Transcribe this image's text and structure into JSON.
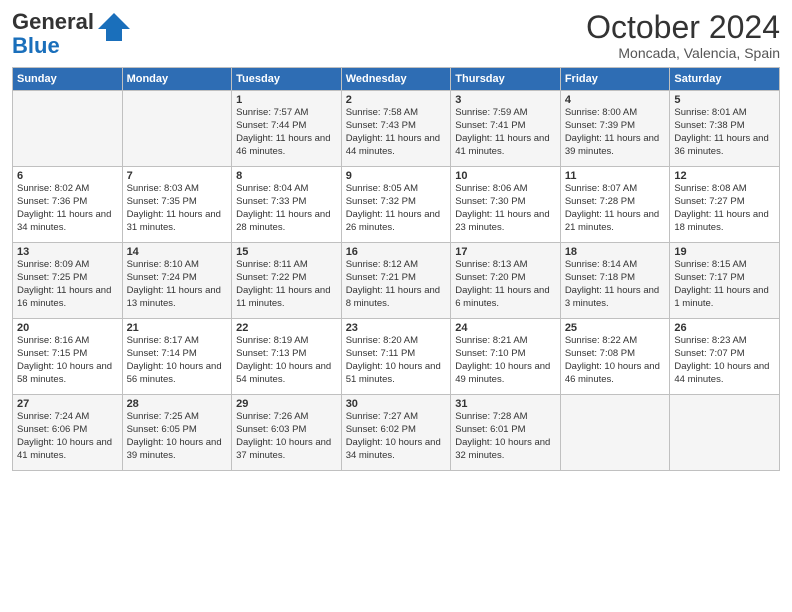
{
  "header": {
    "logo_general": "General",
    "logo_blue": "Blue",
    "month_title": "October 2024",
    "subtitle": "Moncada, Valencia, Spain"
  },
  "days_of_week": [
    "Sunday",
    "Monday",
    "Tuesday",
    "Wednesday",
    "Thursday",
    "Friday",
    "Saturday"
  ],
  "weeks": [
    [
      {
        "day": "",
        "info": ""
      },
      {
        "day": "",
        "info": ""
      },
      {
        "day": "1",
        "info": "Sunrise: 7:57 AM\nSunset: 7:44 PM\nDaylight: 11 hours and 46 minutes."
      },
      {
        "day": "2",
        "info": "Sunrise: 7:58 AM\nSunset: 7:43 PM\nDaylight: 11 hours and 44 minutes."
      },
      {
        "day": "3",
        "info": "Sunrise: 7:59 AM\nSunset: 7:41 PM\nDaylight: 11 hours and 41 minutes."
      },
      {
        "day": "4",
        "info": "Sunrise: 8:00 AM\nSunset: 7:39 PM\nDaylight: 11 hours and 39 minutes."
      },
      {
        "day": "5",
        "info": "Sunrise: 8:01 AM\nSunset: 7:38 PM\nDaylight: 11 hours and 36 minutes."
      }
    ],
    [
      {
        "day": "6",
        "info": "Sunrise: 8:02 AM\nSunset: 7:36 PM\nDaylight: 11 hours and 34 minutes."
      },
      {
        "day": "7",
        "info": "Sunrise: 8:03 AM\nSunset: 7:35 PM\nDaylight: 11 hours and 31 minutes."
      },
      {
        "day": "8",
        "info": "Sunrise: 8:04 AM\nSunset: 7:33 PM\nDaylight: 11 hours and 28 minutes."
      },
      {
        "day": "9",
        "info": "Sunrise: 8:05 AM\nSunset: 7:32 PM\nDaylight: 11 hours and 26 minutes."
      },
      {
        "day": "10",
        "info": "Sunrise: 8:06 AM\nSunset: 7:30 PM\nDaylight: 11 hours and 23 minutes."
      },
      {
        "day": "11",
        "info": "Sunrise: 8:07 AM\nSunset: 7:28 PM\nDaylight: 11 hours and 21 minutes."
      },
      {
        "day": "12",
        "info": "Sunrise: 8:08 AM\nSunset: 7:27 PM\nDaylight: 11 hours and 18 minutes."
      }
    ],
    [
      {
        "day": "13",
        "info": "Sunrise: 8:09 AM\nSunset: 7:25 PM\nDaylight: 11 hours and 16 minutes."
      },
      {
        "day": "14",
        "info": "Sunrise: 8:10 AM\nSunset: 7:24 PM\nDaylight: 11 hours and 13 minutes."
      },
      {
        "day": "15",
        "info": "Sunrise: 8:11 AM\nSunset: 7:22 PM\nDaylight: 11 hours and 11 minutes."
      },
      {
        "day": "16",
        "info": "Sunrise: 8:12 AM\nSunset: 7:21 PM\nDaylight: 11 hours and 8 minutes."
      },
      {
        "day": "17",
        "info": "Sunrise: 8:13 AM\nSunset: 7:20 PM\nDaylight: 11 hours and 6 minutes."
      },
      {
        "day": "18",
        "info": "Sunrise: 8:14 AM\nSunset: 7:18 PM\nDaylight: 11 hours and 3 minutes."
      },
      {
        "day": "19",
        "info": "Sunrise: 8:15 AM\nSunset: 7:17 PM\nDaylight: 11 hours and 1 minute."
      }
    ],
    [
      {
        "day": "20",
        "info": "Sunrise: 8:16 AM\nSunset: 7:15 PM\nDaylight: 10 hours and 58 minutes."
      },
      {
        "day": "21",
        "info": "Sunrise: 8:17 AM\nSunset: 7:14 PM\nDaylight: 10 hours and 56 minutes."
      },
      {
        "day": "22",
        "info": "Sunrise: 8:19 AM\nSunset: 7:13 PM\nDaylight: 10 hours and 54 minutes."
      },
      {
        "day": "23",
        "info": "Sunrise: 8:20 AM\nSunset: 7:11 PM\nDaylight: 10 hours and 51 minutes."
      },
      {
        "day": "24",
        "info": "Sunrise: 8:21 AM\nSunset: 7:10 PM\nDaylight: 10 hours and 49 minutes."
      },
      {
        "day": "25",
        "info": "Sunrise: 8:22 AM\nSunset: 7:08 PM\nDaylight: 10 hours and 46 minutes."
      },
      {
        "day": "26",
        "info": "Sunrise: 8:23 AM\nSunset: 7:07 PM\nDaylight: 10 hours and 44 minutes."
      }
    ],
    [
      {
        "day": "27",
        "info": "Sunrise: 7:24 AM\nSunset: 6:06 PM\nDaylight: 10 hours and 41 minutes."
      },
      {
        "day": "28",
        "info": "Sunrise: 7:25 AM\nSunset: 6:05 PM\nDaylight: 10 hours and 39 minutes."
      },
      {
        "day": "29",
        "info": "Sunrise: 7:26 AM\nSunset: 6:03 PM\nDaylight: 10 hours and 37 minutes."
      },
      {
        "day": "30",
        "info": "Sunrise: 7:27 AM\nSunset: 6:02 PM\nDaylight: 10 hours and 34 minutes."
      },
      {
        "day": "31",
        "info": "Sunrise: 7:28 AM\nSunset: 6:01 PM\nDaylight: 10 hours and 32 minutes."
      },
      {
        "day": "",
        "info": ""
      },
      {
        "day": "",
        "info": ""
      }
    ]
  ]
}
